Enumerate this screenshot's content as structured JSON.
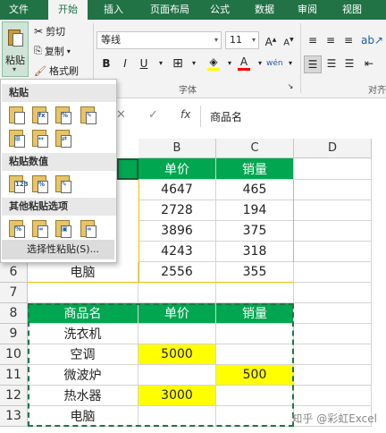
{
  "tabs": [
    "文件",
    "开始",
    "插入",
    "页面布局",
    "公式",
    "数据",
    "审阅",
    "视图"
  ],
  "active_tab": "开始",
  "ribbon": {
    "paste_label": "粘贴",
    "cut_label": "剪切",
    "copy_label": "复制",
    "format_painter_label": "格式刷",
    "font_name": "等线",
    "font_size": "11",
    "font_group_label": "字体",
    "align_group_label": "对齐"
  },
  "formula_bar": {
    "content": "商品名"
  },
  "paste_menu": {
    "section_paste": "粘贴",
    "section_values": "粘贴数值",
    "section_other": "其他粘贴选项",
    "paste_special": "选择性粘贴(S)..."
  },
  "column_headers": [
    "B",
    "C",
    "D"
  ],
  "row_headers": [
    "6",
    "7",
    "8",
    "9",
    "10",
    "11",
    "12",
    "13"
  ],
  "top_table": {
    "headers": [
      "单价",
      "销量"
    ],
    "rows": [
      [
        "4647",
        "465"
      ],
      [
        "2728",
        "194"
      ],
      [
        "3896",
        "375"
      ],
      [
        "4243",
        "318"
      ]
    ],
    "last_row": [
      "电脑",
      "2556",
      "355"
    ]
  },
  "bottom_table": {
    "headers": [
      "商品名",
      "单价",
      "销量"
    ],
    "rows": [
      [
        "洗衣机",
        "",
        ""
      ],
      [
        "空调",
        "5000",
        ""
      ],
      [
        "微波炉",
        "",
        "500"
      ],
      [
        "热水器",
        "3000",
        ""
      ],
      [
        "电脑",
        "",
        ""
      ]
    ]
  },
  "watermark": "知乎 @彩虹Excel",
  "colors": {
    "excel_green": "#217346",
    "header_green": "#00a650",
    "highlight_yellow": "#ffff00"
  }
}
